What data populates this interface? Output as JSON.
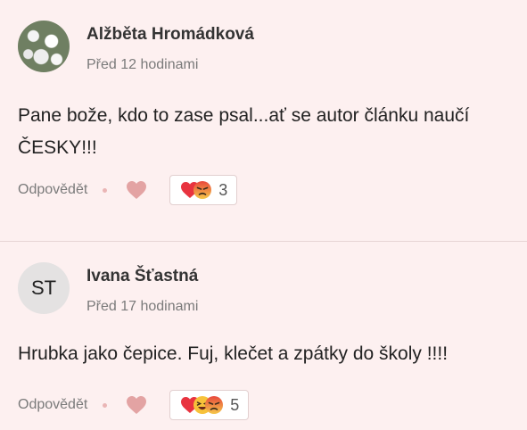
{
  "comments": [
    {
      "author": "Alžběta Hromádková",
      "time": "Před 12 hodinami",
      "text": "Pane bože, kdo to zase psal...ať se autor článku naučí ČESKY!!!",
      "reply_label": "Odpovědět",
      "reaction_count": "3",
      "reactions": [
        "heart-icon",
        "angry-face-icon"
      ]
    },
    {
      "author": "Ivana Šťastná",
      "avatar_initials": "ST",
      "time": "Před 17 hodinami",
      "text": "Hrubka jako čepice. Fuj, klečet a zpátky do školy !!!!",
      "reply_label": "Odpovědět",
      "reaction_count": "5",
      "reactions": [
        "heart-icon",
        "laughing-face-icon",
        "angry-face-icon"
      ]
    }
  ],
  "colors": {
    "background": "#fdf0f0",
    "like_heart": "#e3a3a3",
    "divider": "#e6d4d4"
  }
}
